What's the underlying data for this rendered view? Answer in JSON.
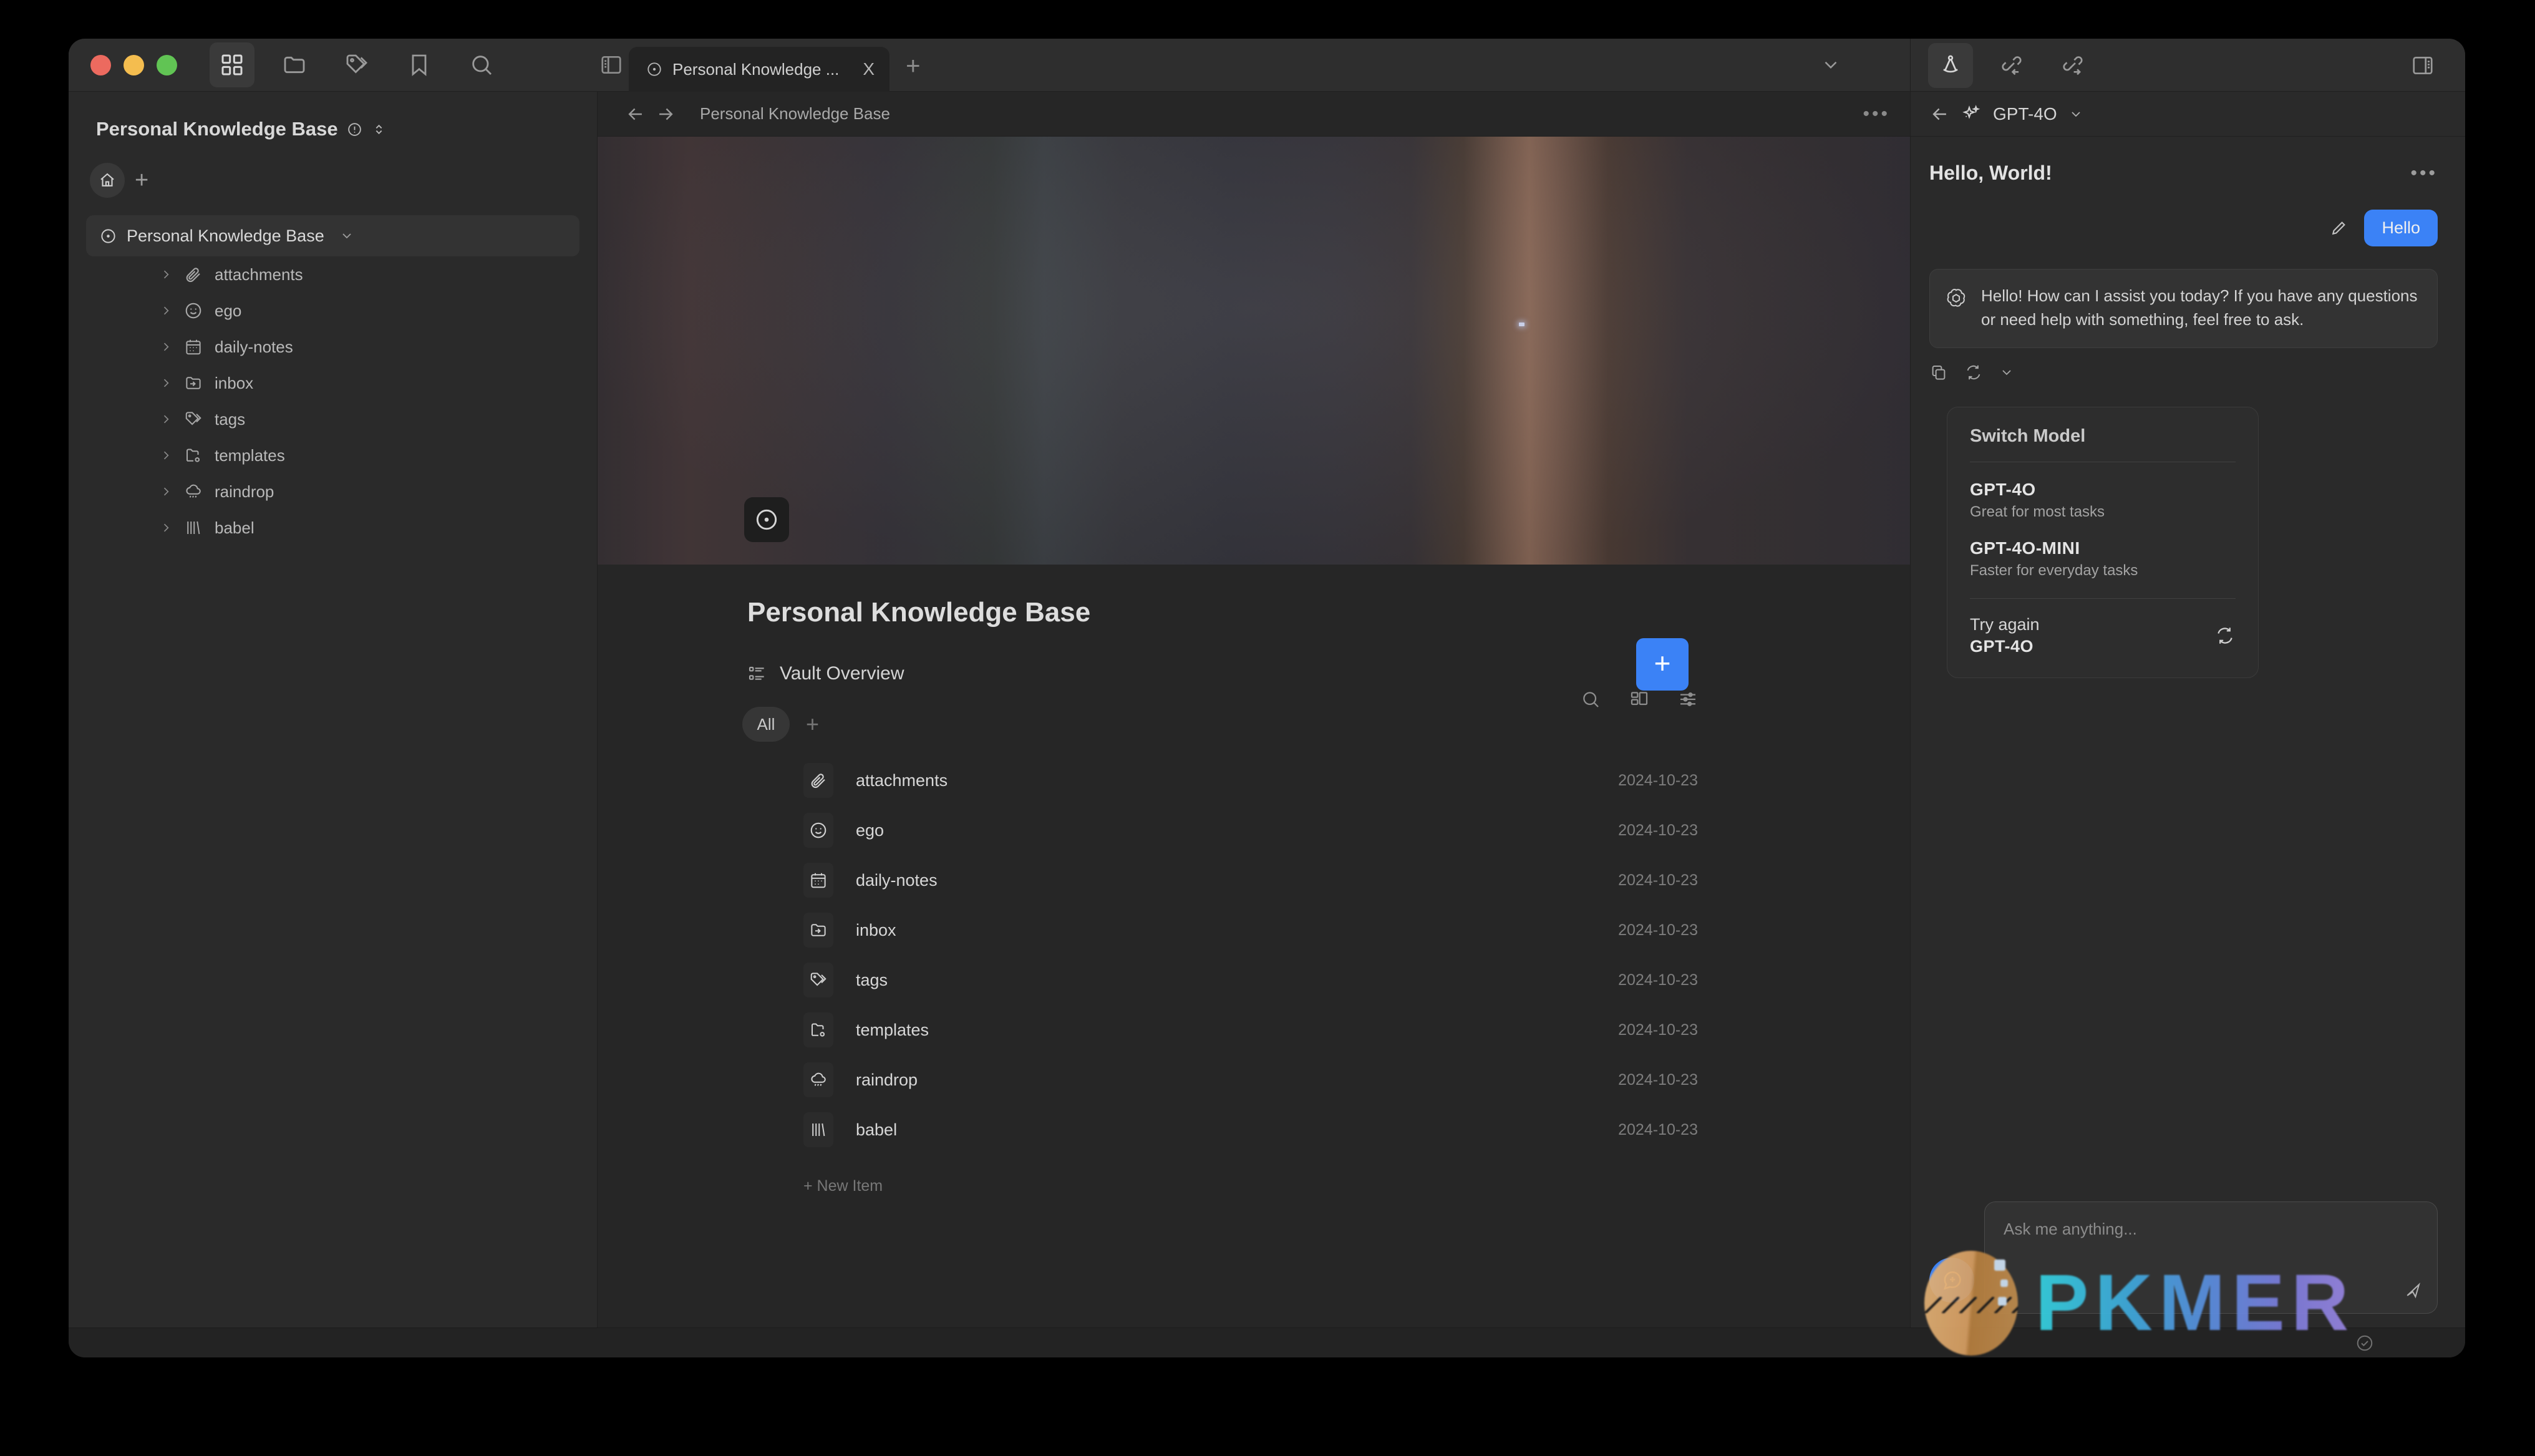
{
  "window": {
    "traffic_lights": [
      "close",
      "minimize",
      "zoom"
    ],
    "toolbar_icons": [
      "grid-icon",
      "folder-icon",
      "tags-icon",
      "bookmark-icon",
      "search-icon"
    ]
  },
  "tabs": {
    "items": [
      {
        "title": "Personal Knowledge ...",
        "close_label": "X"
      }
    ],
    "new_tab_label": "+"
  },
  "sidebar": {
    "vault_title": "Personal Knowledge Base",
    "actions": [
      "home-icon",
      "plus-icon"
    ],
    "root": {
      "label": "Personal Knowledge Base"
    },
    "items": [
      {
        "label": "attachments",
        "icon": "paperclip-icon"
      },
      {
        "label": "ego",
        "icon": "smiley-icon"
      },
      {
        "label": "daily-notes",
        "icon": "calendar-icon"
      },
      {
        "label": "inbox",
        "icon": "inbox-folder-icon"
      },
      {
        "label": "tags",
        "icon": "tags-icon"
      },
      {
        "label": "templates",
        "icon": "folder-cog-icon"
      },
      {
        "label": "raindrop",
        "icon": "raindrop-icon"
      },
      {
        "label": "babel",
        "icon": "library-icon"
      }
    ]
  },
  "main": {
    "breadcrumb": "Personal Knowledge Base",
    "doc_title": "Personal Knowledge Base",
    "banner_alt": "pale-blue-dot-banner",
    "section": {
      "title": "Vault Overview",
      "add_label": "+"
    },
    "filters": {
      "chips": [
        "All"
      ],
      "add_chip_label": "+",
      "tools": [
        "search-icon",
        "layout-icon",
        "settings-sliders-icon"
      ]
    },
    "list": {
      "rows": [
        {
          "name": "attachments",
          "date": "2024-10-23",
          "icon": "paperclip-icon"
        },
        {
          "name": "ego",
          "date": "2024-10-23",
          "icon": "smiley-icon"
        },
        {
          "name": "daily-notes",
          "date": "2024-10-23",
          "icon": "calendar-icon"
        },
        {
          "name": "inbox",
          "date": "2024-10-23",
          "icon": "inbox-folder-icon"
        },
        {
          "name": "tags",
          "date": "2024-10-23",
          "icon": "tags-icon"
        },
        {
          "name": "templates",
          "date": "2024-10-23",
          "icon": "folder-cog-icon"
        },
        {
          "name": "raindrop",
          "date": "2024-10-23",
          "icon": "raindrop-icon"
        },
        {
          "name": "babel",
          "date": "2024-10-23",
          "icon": "library-icon"
        }
      ],
      "new_item_label": "+ New Item"
    }
  },
  "ai_panel": {
    "toolbar_icons": [
      "compass-icon",
      "backlinks-icon",
      "outgoing-links-icon",
      "right-panel-toggle-icon"
    ],
    "model": "GPT-4O",
    "chat_title": "Hello, World!",
    "user_message": "Hello",
    "assistant_message": "Hello! How can I assist you today? If you have any questions or need help with something, feel free to ask.",
    "assistant_actions": [
      "copy-icon",
      "regenerate-icon",
      "chevron-down-icon"
    ],
    "switch_model": {
      "title": "Switch Model",
      "options": [
        {
          "name": "GPT-4O",
          "desc": "Great for most tasks"
        },
        {
          "name": "GPT-4O-MINI",
          "desc": "Faster for everyday tasks"
        }
      ],
      "try_again_label": "Try again",
      "try_again_model": "GPT-4O"
    },
    "composer": {
      "placeholder": "Ask me anything...",
      "send_icon": "send-icon",
      "new_chat_icon": "new-chat-icon"
    }
  },
  "watermark": {
    "text": "PKMER"
  },
  "colors": {
    "accent": "#3b82f6",
    "window_bg": "#2a2a2a",
    "main_bg": "#262626",
    "tab_active_bg": "#232323",
    "text_primary": "#d8d8d8",
    "text_muted": "#7d7d7d",
    "traffic_red": "#ec6a5f",
    "traffic_yellow": "#f4bd4f",
    "traffic_green": "#61c454"
  }
}
